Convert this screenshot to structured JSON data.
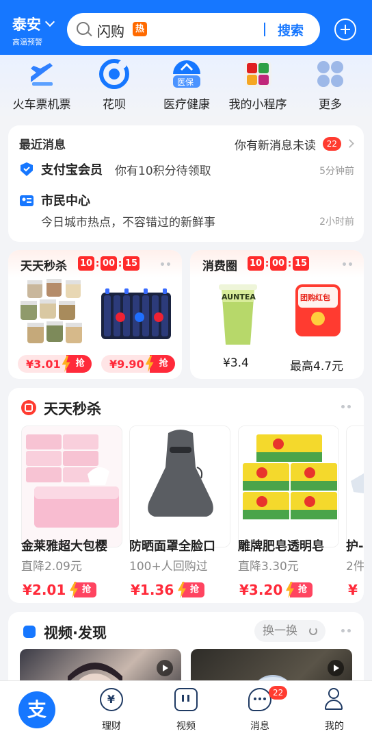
{
  "header": {
    "city": "泰安",
    "city_sub": "高温预警",
    "search_text": "闪购",
    "hot_badge": "热",
    "search_button": "搜索"
  },
  "shortcuts": [
    {
      "label": "火车票机票",
      "icon": "train-plane-icon"
    },
    {
      "label": "花呗",
      "icon": "huabei-icon"
    },
    {
      "label": "医疗健康",
      "icon": "medical-insurance-icon",
      "icon_text": "医保"
    },
    {
      "label": "我的小程序",
      "icon": "mini-programs-icon"
    },
    {
      "label": "更多",
      "icon": "more-icon"
    }
  ],
  "messages": {
    "title": "最近消息",
    "unread_text": "你有新消息未读",
    "unread_count": "22",
    "items": [
      {
        "name": "支付宝会员",
        "text": "你有10积分待领取",
        "time": "5分钟前"
      },
      {
        "name": "市民中心",
        "text": "今日城市热点，不容错过的新鲜事",
        "time": "2小时前"
      }
    ]
  },
  "flash_mini": {
    "title": "天天秒杀",
    "timer": [
      "10",
      "00",
      "15"
    ],
    "items": [
      {
        "price": "¥3.01",
        "grab": "抢"
      },
      {
        "price": "¥9.90",
        "grab": "抢"
      }
    ]
  },
  "consumption": {
    "title": "消费圈",
    "timer": [
      "10",
      "00",
      "15"
    ],
    "items": [
      {
        "label": "¥3.4",
        "image_text": "AUNTEA"
      },
      {
        "label": "最高4.7元",
        "image_text": "团购红包"
      }
    ]
  },
  "seckill": {
    "title": "天天秒杀",
    "products": [
      {
        "name": "金莱雅超大包樱",
        "sub": "直降2.09元",
        "price": "¥2.01",
        "grab": "抢"
      },
      {
        "name": "防晒面罩全脸口",
        "sub": "100+人回购过",
        "price": "¥1.36",
        "grab": "抢"
      },
      {
        "name": "雕牌肥皂透明皂",
        "sub": "直降3.30元",
        "price": "¥3.20",
        "grab": "抢"
      },
      {
        "name": "护-",
        "sub": "2件",
        "price": "¥",
        "grab": ""
      }
    ]
  },
  "video": {
    "title": "视频·发现",
    "refresh": "换一换"
  },
  "tabbar": {
    "items": [
      {
        "label": "理财",
        "icon": "wealth-icon"
      },
      {
        "label": "视频",
        "icon": "video-icon"
      },
      {
        "label": "消息",
        "icon": "message-icon"
      },
      {
        "label": "我的",
        "icon": "profile-icon"
      }
    ],
    "home_glyph": "支",
    "message_badge": "22"
  },
  "colors": {
    "brand": "#1677ff",
    "accent_red": "#ff2a3a",
    "background": "#f3f4f7"
  }
}
